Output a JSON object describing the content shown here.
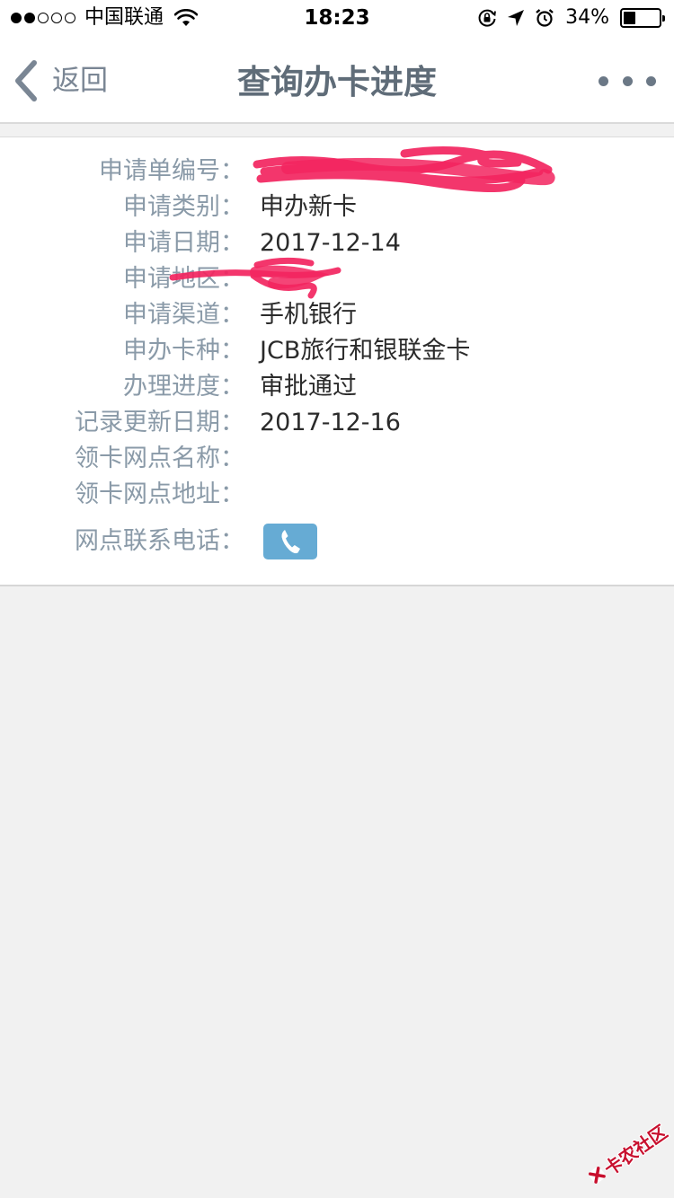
{
  "status_bar": {
    "carrier": "中国联通",
    "time": "18:23",
    "battery_percent": "34%",
    "battery_level": 0.34,
    "signal_bars_filled": 2,
    "signal_bars_total": 5,
    "icons": [
      "wifi-icon",
      "orientation-lock-icon",
      "location-arrow-icon",
      "alarm-icon",
      "battery-icon"
    ]
  },
  "nav": {
    "back_label": "返回",
    "title": "查询办卡进度",
    "more_icon": "more-dots-icon"
  },
  "rows": [
    {
      "label": "申请单编号：",
      "value": "",
      "redacted": true
    },
    {
      "label": "申请类别：",
      "value": "申办新卡"
    },
    {
      "label": "申请日期：",
      "value": "2017-12-14"
    },
    {
      "label": "申请地区：",
      "value": "",
      "redacted": true
    },
    {
      "label": "申请渠道：",
      "value": "手机银行"
    },
    {
      "label": "申办卡种：",
      "value": "JCB旅行和银联金卡"
    },
    {
      "label": "办理进度：",
      "value": "审批通过"
    },
    {
      "label": "记录更新日期：",
      "value": "2017-12-16"
    },
    {
      "label": "领卡网点名称：",
      "value": ""
    },
    {
      "label": "领卡网点地址：",
      "value": ""
    },
    {
      "label": "网点联系电话：",
      "value": "",
      "button_icon": "phone-icon"
    }
  ],
  "colors": {
    "accent_blue": "#66abd4",
    "label_gray": "#8a9aa8",
    "title_gray": "#5f6c78",
    "redaction_pink": "#f2255f",
    "watermark_red": "#c8102e"
  },
  "watermark": {
    "text": "卡农社区"
  }
}
